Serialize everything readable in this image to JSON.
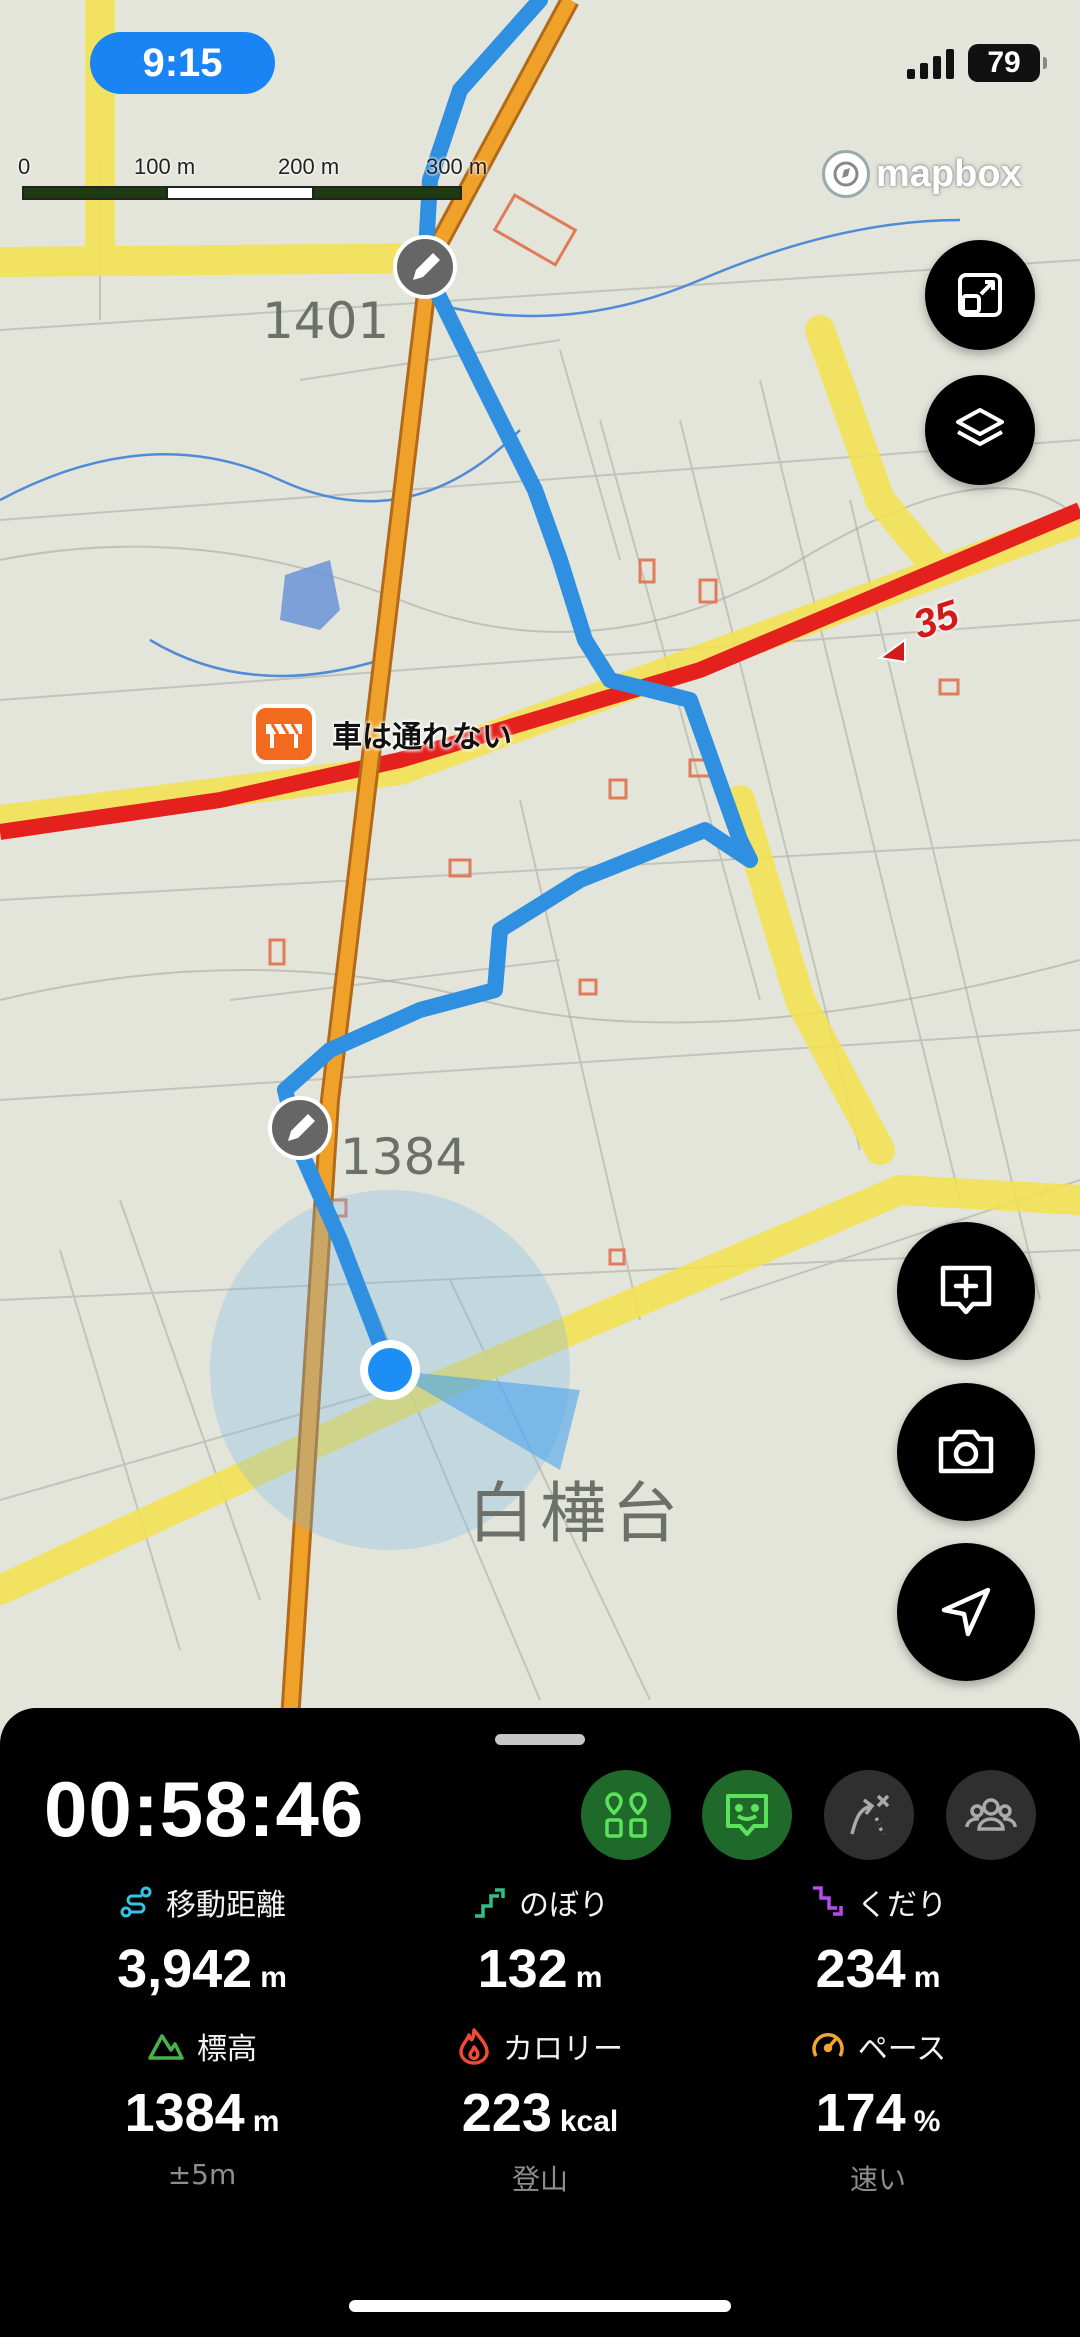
{
  "status_bar": {
    "time": "9:15",
    "battery": "79"
  },
  "map": {
    "scale_labels": [
      "0",
      "100 m",
      "200 m",
      "300 m"
    ],
    "attribution": "mapbox",
    "poi_label": "車は通れない",
    "elevation_labels": [
      "1401",
      "1384"
    ],
    "place_name": "白樺台",
    "route_number": "35",
    "colors": {
      "track": "#2f8fe0",
      "road_red": "#e5211e",
      "road_orange": "#f0a12a",
      "highlight_yellow": "#f4e24c",
      "location_dot": "#1e8ef7"
    },
    "icons": [
      "expand-icon",
      "layers-icon",
      "add-comment-icon",
      "camera-icon",
      "navigate-icon",
      "pencil-icon"
    ]
  },
  "sheet": {
    "timer": "00:58:46",
    "modes": [
      "route-marker-icon",
      "chat-face-icon",
      "route-off-icon",
      "group-icon"
    ],
    "stats": [
      {
        "label": "移動距離",
        "value": "3,942",
        "unit": "m",
        "sub": "",
        "icon": "distance-icon",
        "color": "#35c3e6"
      },
      {
        "label": "のぼり",
        "value": "132",
        "unit": "m",
        "sub": "",
        "icon": "ascent-icon",
        "color": "#2dc189"
      },
      {
        "label": "くだり",
        "value": "234",
        "unit": "m",
        "sub": "",
        "icon": "descent-icon",
        "color": "#b44cf0"
      },
      {
        "label": "標高",
        "value": "1384",
        "unit": "m",
        "sub": "±5m",
        "icon": "mountain-icon",
        "color": "#49b24d"
      },
      {
        "label": "カロリー",
        "value": "223",
        "unit": "kcal",
        "sub": "登山",
        "icon": "flame-icon",
        "color": "#f04a37"
      },
      {
        "label": "ペース",
        "value": "174",
        "unit": "%",
        "sub": "速い",
        "icon": "gauge-icon",
        "color": "#f2a533"
      }
    ]
  }
}
